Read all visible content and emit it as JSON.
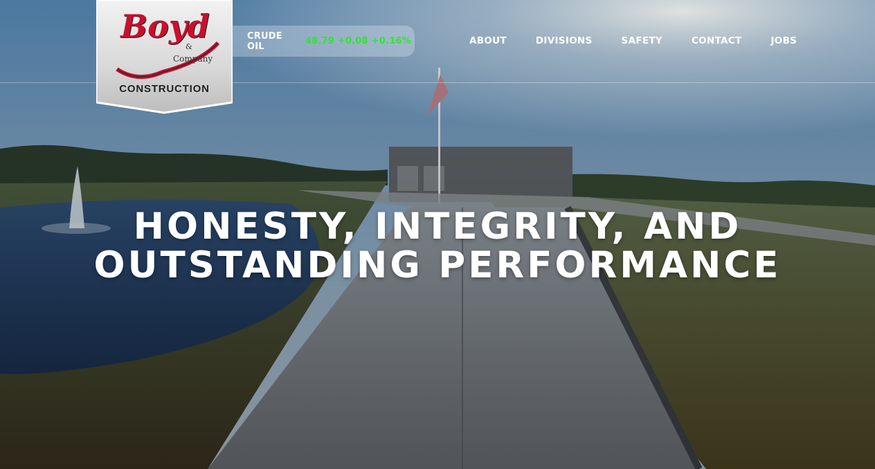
{
  "brand": {
    "logo_script": "Boyd",
    "logo_amp": "&",
    "logo_company": "Company",
    "logo_construction": "CONSTRUCTION"
  },
  "ticker": {
    "symbol": "CRUDE OIL",
    "price": "48.79",
    "change": "+0.08",
    "change_pct": "+0.16%",
    "change_color": "#2ee62e"
  },
  "nav": {
    "items": [
      {
        "label": "ABOUT"
      },
      {
        "label": "DIVISIONS"
      },
      {
        "label": "SAFETY"
      },
      {
        "label": "CONTACT"
      },
      {
        "label": "JOBS"
      }
    ]
  },
  "hero": {
    "line1": "HONESTY, INTEGRITY, AND",
    "line2": "OUTSTANDING PERFORMANCE"
  },
  "colors": {
    "logo_red": "#c8102e",
    "text": "#ffffff"
  }
}
